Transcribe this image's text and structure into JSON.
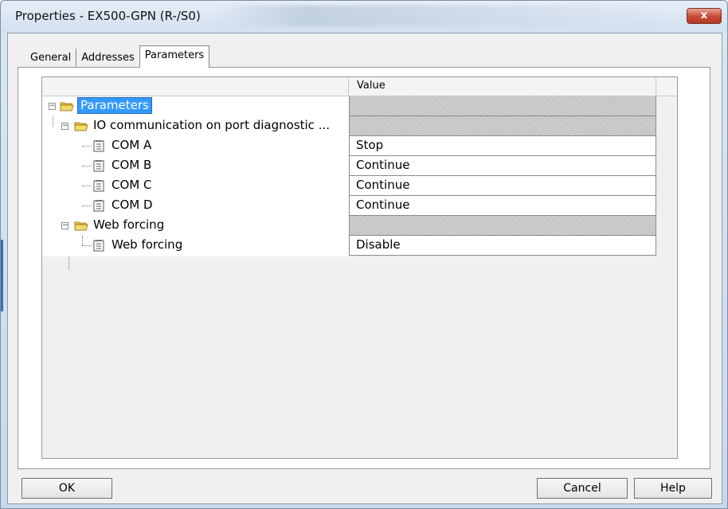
{
  "window": {
    "title": "Properties - EX500-GPN  (R-/S0)",
    "close_label": "x"
  },
  "tabs": [
    {
      "label": "General"
    },
    {
      "label": "Addresses"
    },
    {
      "label": "Parameters",
      "active": true
    }
  ],
  "grid": {
    "columns": [
      "",
      "Value"
    ],
    "rows": [
      {
        "name": "Parameters",
        "value": "",
        "level": 0,
        "type": "folder",
        "expander": "−",
        "selected": true
      },
      {
        "name": "IO communication on port diagnostic ...",
        "value": "",
        "level": 1,
        "type": "folder",
        "expander": "−"
      },
      {
        "name": "COM A",
        "value": "Stop",
        "level": 2,
        "type": "item"
      },
      {
        "name": "COM B",
        "value": "Continue",
        "level": 2,
        "type": "item"
      },
      {
        "name": "COM C",
        "value": "Continue",
        "level": 2,
        "type": "item"
      },
      {
        "name": "COM D",
        "value": "Continue",
        "level": 2,
        "type": "item"
      },
      {
        "name": "Web forcing",
        "value": "",
        "level": 1,
        "type": "folder",
        "expander": "−"
      },
      {
        "name": "Web forcing",
        "value": "Disable",
        "level": 2,
        "type": "item"
      }
    ]
  },
  "buttons": {
    "ok": "OK",
    "cancel": "Cancel",
    "help": "Help"
  },
  "colors": {
    "selection": "#3399ff",
    "close_button": "#c64a33"
  }
}
